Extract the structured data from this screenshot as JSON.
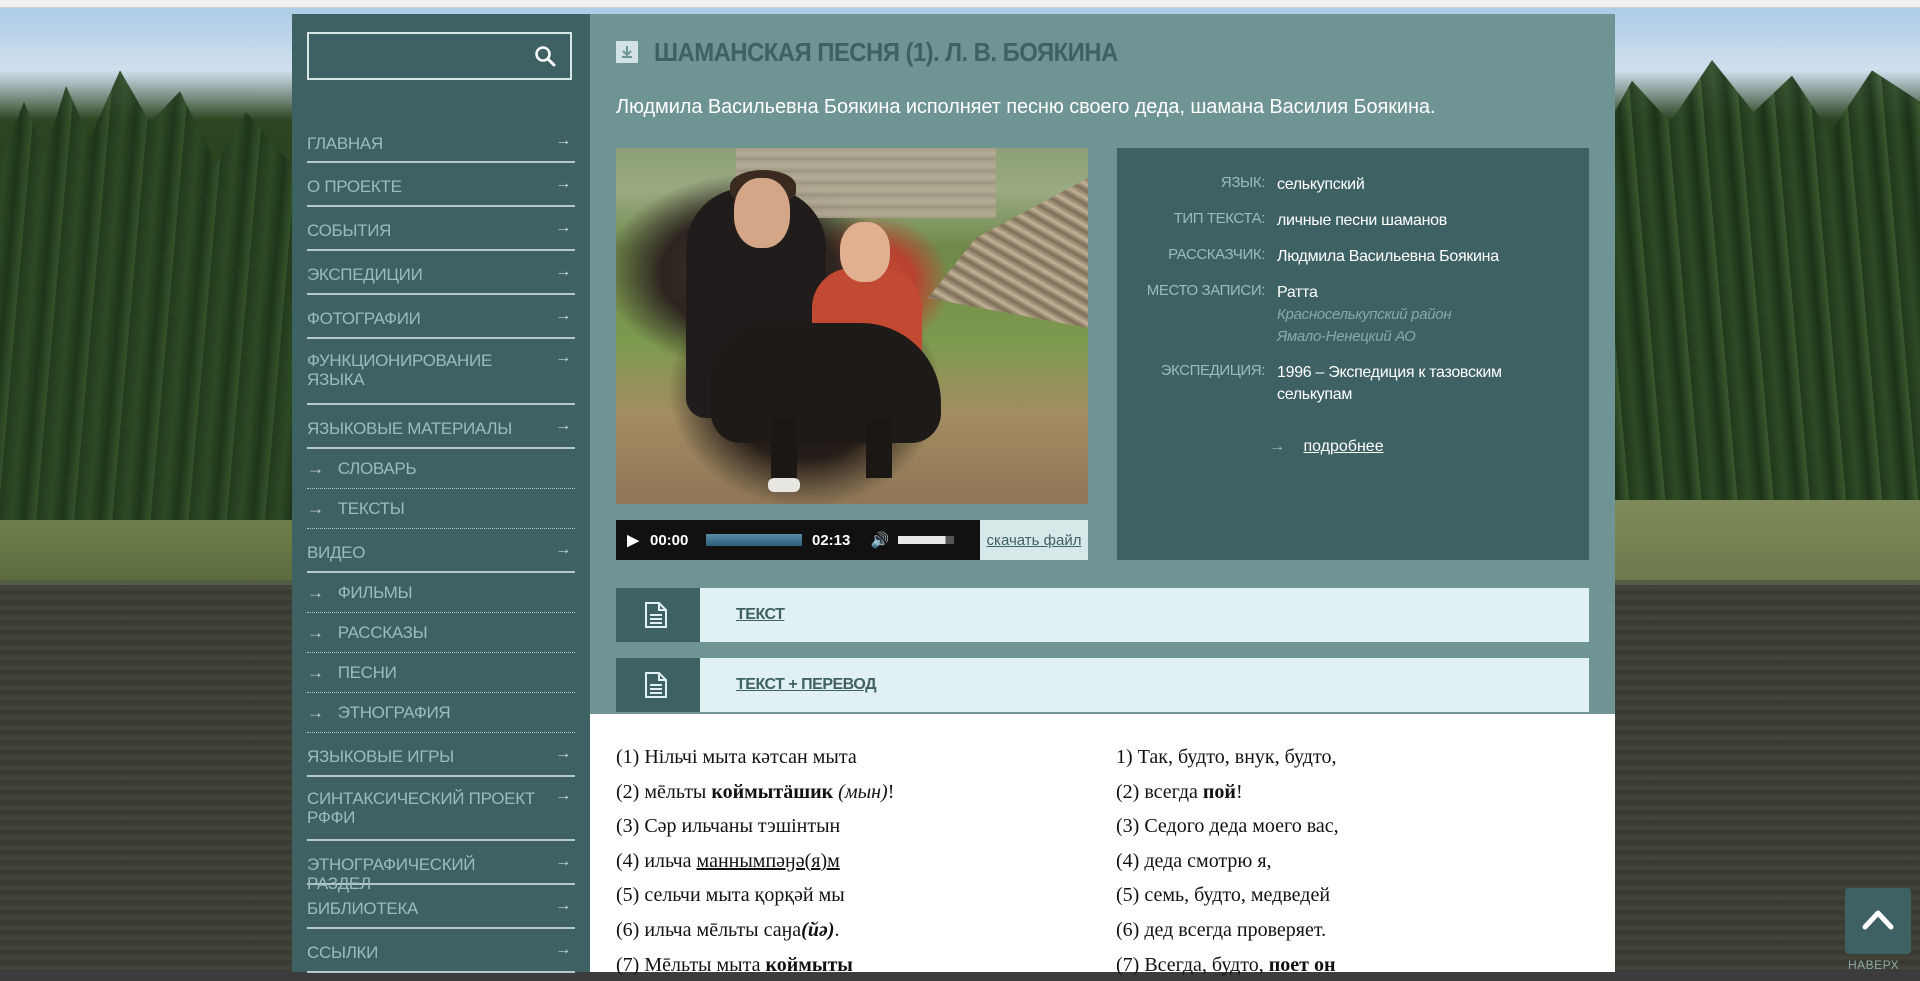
{
  "search": {
    "placeholder": ""
  },
  "sidebar": {
    "items": [
      {
        "label": "ГЛАВНАЯ",
        "type": "main"
      },
      {
        "label": "О ПРОЕКТЕ",
        "type": "main"
      },
      {
        "label": "СОБЫТИЯ",
        "type": "main"
      },
      {
        "label": "ЭКСПЕДИЦИИ",
        "type": "main"
      },
      {
        "label": "ФОТОГРАФИИ",
        "type": "main"
      },
      {
        "label": "ФУНКЦИОНИРОВАНИЕ ЯЗЫКА",
        "type": "main"
      },
      {
        "label": "ЯЗЫКОВЫЕ МАТЕРИАЛЫ",
        "type": "main"
      },
      {
        "label": "СЛОВАРЬ",
        "type": "sub"
      },
      {
        "label": "ТЕКСТЫ",
        "type": "sub"
      },
      {
        "label": "ВИДЕО",
        "type": "main"
      },
      {
        "label": "ФИЛЬМЫ",
        "type": "sub"
      },
      {
        "label": "РАССКАЗЫ",
        "type": "sub"
      },
      {
        "label": "ПЕСНИ",
        "type": "sub"
      },
      {
        "label": "ЭТНОГРАФИЯ",
        "type": "sub"
      },
      {
        "label": "ЯЗЫКОВЫЕ ИГРЫ",
        "type": "main"
      },
      {
        "label": "СИНТАКСИЧЕСКИЙ ПРОЕКТ РФФИ",
        "type": "main"
      },
      {
        "label": "ЭТНОГРАФИЧЕСКИЙ РАЗДЕЛ",
        "type": "main"
      },
      {
        "label": "БИБЛИОТЕКА",
        "type": "main"
      },
      {
        "label": "ССЫЛКИ",
        "type": "main"
      }
    ],
    "arrow": "→"
  },
  "page": {
    "title": "ШАМАНСКАЯ ПЕСНЯ (1). Л. В. БОЯКИНА",
    "lead": "Людмила Васильевна Боякина исполняет песню своего деда, шамана Василия Боякина."
  },
  "player": {
    "current_time": "00:00",
    "duration": "02:13",
    "progress_fraction": 0,
    "volume_fraction": 0.85,
    "download_label": "скачать файл"
  },
  "info": {
    "language_key": "ЯЗЫК:",
    "language_val": "селькупский",
    "text_type_key": "ТИП ТЕКСТА:",
    "text_type_val": "личные песни шаманов",
    "narrator_key": "РАССКАЗЧИК:",
    "narrator_val": "Людмила Васильевна Боякина",
    "place_key": "МЕСТО ЗАПИСИ:",
    "place_val": "Ратта",
    "place_region": "Красноселькупский район",
    "place_district": "Ямало-Ненецкий АО",
    "expedition_key": "ЭКСПЕДИЦИЯ:",
    "expedition_val": "1996 – Экспедиция к тазовским селькупам",
    "more_arrow": "→",
    "more_label": "подробнее"
  },
  "tabs": [
    {
      "label": "ТЕКСТ"
    },
    {
      "label": "ТЕКСТ + ПЕРЕВОД"
    }
  ],
  "text": {
    "original": [
      {
        "pre": "(1) Нільчі мыта кәтсан мыта",
        "bold": "",
        "italic": "",
        "post": ""
      },
      {
        "pre": "(2) мēльты ",
        "bold": "коймытäшик",
        "italic": " (мын)",
        "post": "!"
      },
      {
        "pre": "(3) Сәр ильчаны тэшінтын",
        "bold": "",
        "italic": "",
        "post": ""
      },
      {
        "pre": "(4) ильча ",
        "underline": "маннымпәӈә(я)м",
        "post": ""
      },
      {
        "pre": "(5) сельчи мыта қорқәй мы",
        "bold": "",
        "italic": "",
        "post": ""
      },
      {
        "pre": "(6) ильча мēльты саӈа",
        "bold_italic": "(йә)",
        "post": "."
      },
      {
        "pre": "(7) Мēльты мыта ",
        "bold": "коймыты",
        "post": ""
      }
    ],
    "translation": [
      {
        "pre": "1) Так, будто, внук, будто,",
        "bold": "",
        "post": ""
      },
      {
        "pre": "(2) всегда ",
        "bold": "пой",
        "post": "!"
      },
      {
        "pre": "(3) Седого деда моего вас,",
        "bold": "",
        "post": ""
      },
      {
        "pre": "(4) деда смотрю я,",
        "bold": "",
        "post": ""
      },
      {
        "pre": "(5) семь, будто, медведей",
        "bold": "",
        "post": ""
      },
      {
        "pre": "(6) дед всегда проверяет.",
        "bold": "",
        "post": ""
      },
      {
        "pre": "(7) Всегда, будто, ",
        "bold": "поет он",
        "post": ""
      }
    ]
  },
  "to_top": {
    "label": "НАВЕРХ"
  },
  "colors": {
    "sidebar_bg": "#3e6163",
    "main_bg": "#6f9494",
    "menu_text": "#9cbcbc",
    "tab_bg": "#e1f1f3",
    "title_color": "#3e6163"
  }
}
